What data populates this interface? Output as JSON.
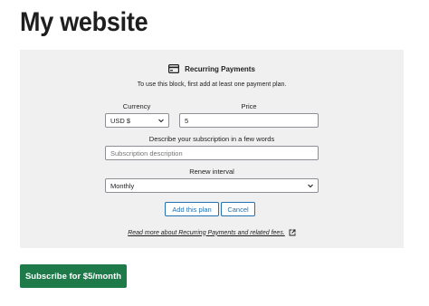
{
  "site": {
    "title": "My website"
  },
  "block": {
    "title": "Recurring Payments",
    "instructions": "To use this block, first add at least one payment plan.",
    "currency": {
      "label": "Currency",
      "value": "USD $"
    },
    "price": {
      "label": "Price",
      "value": "5"
    },
    "description": {
      "label": "Describe your subscription in a few words",
      "placeholder": "Subscription description"
    },
    "interval": {
      "label": "Renew interval",
      "value": "Monthly"
    },
    "add_button": "Add this plan",
    "cancel_button": "Cancel",
    "read_more": "Read more about Recurring Payments and related fees."
  },
  "subscribe_button": "Subscribe for $5/month",
  "colors": {
    "accent": "#2271b1",
    "subscribe_bg": "#1f7a4a",
    "block_bg": "#f0f0f0"
  },
  "icons": [
    "credit-card-icon",
    "chevron-down-icon",
    "external-link-icon"
  ]
}
